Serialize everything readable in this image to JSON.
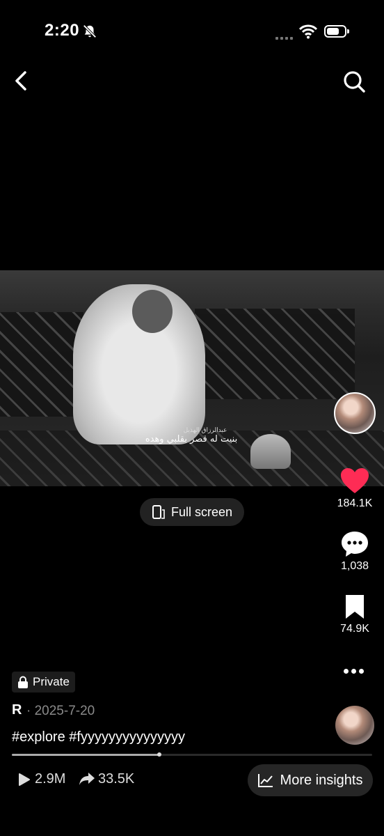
{
  "status_bar": {
    "time": "2:20"
  },
  "video": {
    "subtitle_small": "عبدالرزاق الهذيل",
    "subtitle_main": "بنيت له قصر بقلبي وهده"
  },
  "fullscreen_label": "Full screen",
  "rail": {
    "likes": "184.1K",
    "comments": "1,038",
    "saves": "74.9K",
    "like_color": "#fe2c55"
  },
  "caption": {
    "privacy": "Private",
    "author": "R",
    "date": "· 2025-7-20",
    "hashtags": "#explore #fyyyyyyyyyyyyyyy"
  },
  "progress": {
    "fraction": 0.41
  },
  "stats": {
    "plays": "2.9M",
    "shares": "33.5K",
    "insights_label": "More insights"
  }
}
